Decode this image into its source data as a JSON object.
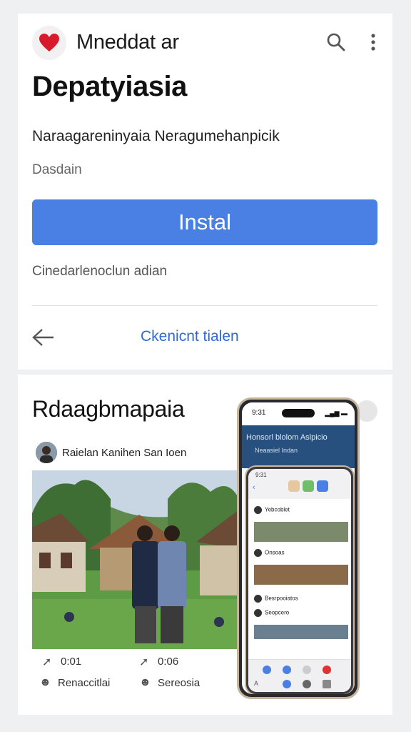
{
  "header": {
    "app_name": "Mneddat ar",
    "search_icon": "search-icon",
    "more_icon": "more-vertical-icon",
    "app_icon": "heart-icon",
    "app_icon_color": "#d81b2c"
  },
  "listing": {
    "title": "Depatyiasia",
    "subtitle": "Naraagareninyaia Neragumehanpicik",
    "meta": "Dasdain",
    "install_label": "Instal",
    "note": "Cinedarlenoclun adian",
    "link_label": "Ckenicnt tialen",
    "back_icon": "arrow-left-icon"
  },
  "preview": {
    "section_title": "Rdaagbmapaia",
    "author": "Raielan Kanihen San Ioen",
    "stats": [
      {
        "icon": "share-icon",
        "value": "0:01"
      },
      {
        "icon": "send-icon",
        "value": "0:06"
      },
      {
        "icon": "people-icon",
        "value": "Renaccitlai"
      },
      {
        "icon": "person-icon",
        "value": "Sereosia"
      }
    ],
    "phone": {
      "time": "9:31",
      "header_title": "Honsorl blolom Aslpicio",
      "header_sub": "Neaasiel Indan",
      "inner_time": "9:31",
      "rows": [
        "Yebcoblet",
        "Onsoas",
        "Besrpooiatos",
        "Seopcero"
      ]
    }
  },
  "colors": {
    "accent": "#4a7fe3",
    "link": "#2d6ad6",
    "background": "#eef0f2"
  }
}
